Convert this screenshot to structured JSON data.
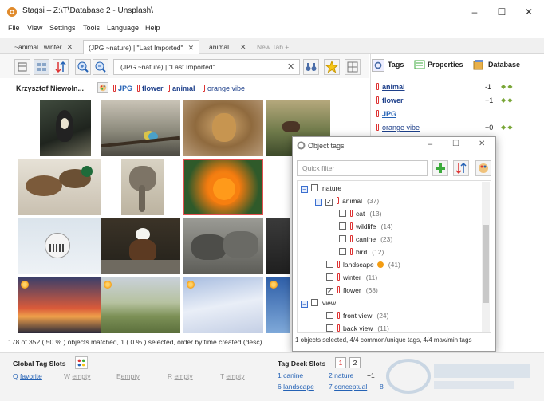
{
  "window": {
    "title": "Stagsi – Z:\\T\\Database 2 - Unsplash\\",
    "minimize": "–",
    "maximize": "☐",
    "close": "✕"
  },
  "menu": [
    "File",
    "View",
    "Settings",
    "Tools",
    "Language",
    "Help"
  ],
  "tabs": [
    {
      "label": "~animal | winter",
      "close": "✕"
    },
    {
      "label": "(JPG ~nature) | \"Last Imported\"",
      "close": "✕"
    },
    {
      "label": "animal",
      "close": "✕"
    },
    {
      "label": "New Tab +"
    }
  ],
  "query": {
    "text": "(JPG ~nature) | \"Last Imported\"",
    "clear": "✕"
  },
  "selected_tags": {
    "author": "Krzysztof Niewoln...",
    "tags": [
      "JPG",
      "flower",
      "animal",
      "orange vibe"
    ]
  },
  "status": "178 of 352 ( 50 % ) objects matched, 1 ( 0 % ) selected, order by time created (desc)",
  "right_panel": {
    "tabs": [
      "Tags",
      "Properties",
      "Database"
    ],
    "rows": [
      {
        "name": "animal",
        "num": "-1"
      },
      {
        "name": "flower",
        "num": "+1"
      },
      {
        "name": "JPG",
        "num": ""
      },
      {
        "name": "orange vibe",
        "num": "+0"
      }
    ]
  },
  "dialog": {
    "title": "Object tags",
    "filter_placeholder": "Quick filter",
    "tree": [
      {
        "label": "nature",
        "count": "",
        "depth": 0,
        "check": "",
        "exp": "−"
      },
      {
        "label": "animal",
        "count": "(37)",
        "depth": 1,
        "check": "✓",
        "exp": "−"
      },
      {
        "label": "cat",
        "count": "(13)",
        "depth": 2,
        "check": "",
        "exp": ""
      },
      {
        "label": "wildlife",
        "count": "(14)",
        "depth": 2,
        "check": "",
        "exp": ""
      },
      {
        "label": "canine",
        "count": "(23)",
        "depth": 2,
        "check": "",
        "exp": ""
      },
      {
        "label": "bird",
        "count": "(12)",
        "depth": 2,
        "check": "",
        "exp": ""
      },
      {
        "label": "landscape",
        "count": "(41)",
        "depth": 1,
        "check": "",
        "exp": ""
      },
      {
        "label": "winter",
        "count": "(11)",
        "depth": 1,
        "check": "",
        "exp": ""
      },
      {
        "label": "flower",
        "count": "(68)",
        "depth": 1,
        "check": "✓",
        "exp": ""
      },
      {
        "label": "view",
        "count": "",
        "depth": 0,
        "check": "",
        "exp": "−"
      },
      {
        "label": "front view",
        "count": "(24)",
        "depth": 1,
        "check": "",
        "exp": ""
      },
      {
        "label": "back view",
        "count": "(11)",
        "depth": 1,
        "check": "",
        "exp": ""
      }
    ],
    "status": "1 objects selected, 4/4 common/unique tags, 4/4 max/min tags"
  },
  "global_slots": {
    "title": "Global Tag Slots",
    "slots": [
      {
        "key": "Q",
        "value": "favorite",
        "empty": false
      },
      {
        "key": "W",
        "value": "empty",
        "empty": true
      },
      {
        "key": "E",
        "value": "empty",
        "empty": true
      },
      {
        "key": "R",
        "value": "empty",
        "empty": true
      },
      {
        "key": "T",
        "value": "empty",
        "empty": true
      }
    ]
  },
  "deck_slots": {
    "title": "Tag Deck Slots",
    "pages": [
      "1",
      "2"
    ],
    "slots": [
      {
        "key": "1",
        "value": "canine"
      },
      {
        "key": "2",
        "value": "nature"
      },
      {
        "key": "+1",
        "value": ""
      },
      {
        "key": "6",
        "value": "landscape"
      },
      {
        "key": "7",
        "value": "conceptual"
      },
      {
        "key": "8",
        "value": ""
      }
    ]
  },
  "colors": {
    "accent": "#2462b5",
    "tag_red": "#dd3333",
    "add_green": "#3cab3c"
  }
}
